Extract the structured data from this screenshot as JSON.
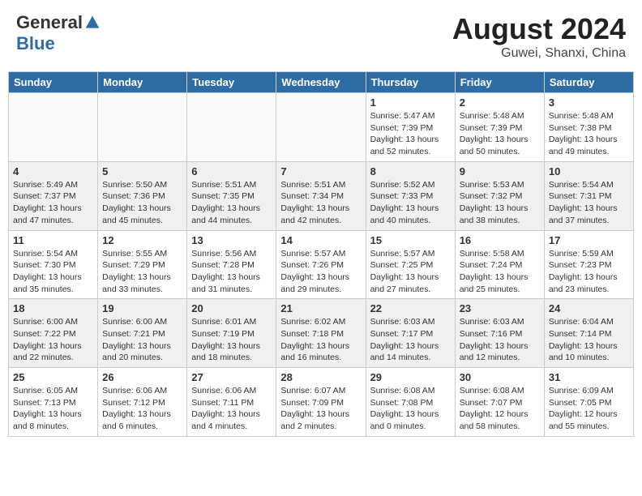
{
  "header": {
    "logo_general": "General",
    "logo_blue": "Blue",
    "title": "August 2024",
    "subtitle": "Guwei, Shanxi, China"
  },
  "days_of_week": [
    "Sunday",
    "Monday",
    "Tuesday",
    "Wednesday",
    "Thursday",
    "Friday",
    "Saturday"
  ],
  "weeks": [
    [
      {
        "day": "",
        "info": ""
      },
      {
        "day": "",
        "info": ""
      },
      {
        "day": "",
        "info": ""
      },
      {
        "day": "",
        "info": ""
      },
      {
        "day": "1",
        "info": "Sunrise: 5:47 AM\nSunset: 7:39 PM\nDaylight: 13 hours\nand 52 minutes."
      },
      {
        "day": "2",
        "info": "Sunrise: 5:48 AM\nSunset: 7:39 PM\nDaylight: 13 hours\nand 50 minutes."
      },
      {
        "day": "3",
        "info": "Sunrise: 5:48 AM\nSunset: 7:38 PM\nDaylight: 13 hours\nand 49 minutes."
      }
    ],
    [
      {
        "day": "4",
        "info": "Sunrise: 5:49 AM\nSunset: 7:37 PM\nDaylight: 13 hours\nand 47 minutes."
      },
      {
        "day": "5",
        "info": "Sunrise: 5:50 AM\nSunset: 7:36 PM\nDaylight: 13 hours\nand 45 minutes."
      },
      {
        "day": "6",
        "info": "Sunrise: 5:51 AM\nSunset: 7:35 PM\nDaylight: 13 hours\nand 44 minutes."
      },
      {
        "day": "7",
        "info": "Sunrise: 5:51 AM\nSunset: 7:34 PM\nDaylight: 13 hours\nand 42 minutes."
      },
      {
        "day": "8",
        "info": "Sunrise: 5:52 AM\nSunset: 7:33 PM\nDaylight: 13 hours\nand 40 minutes."
      },
      {
        "day": "9",
        "info": "Sunrise: 5:53 AM\nSunset: 7:32 PM\nDaylight: 13 hours\nand 38 minutes."
      },
      {
        "day": "10",
        "info": "Sunrise: 5:54 AM\nSunset: 7:31 PM\nDaylight: 13 hours\nand 37 minutes."
      }
    ],
    [
      {
        "day": "11",
        "info": "Sunrise: 5:54 AM\nSunset: 7:30 PM\nDaylight: 13 hours\nand 35 minutes."
      },
      {
        "day": "12",
        "info": "Sunrise: 5:55 AM\nSunset: 7:29 PM\nDaylight: 13 hours\nand 33 minutes."
      },
      {
        "day": "13",
        "info": "Sunrise: 5:56 AM\nSunset: 7:28 PM\nDaylight: 13 hours\nand 31 minutes."
      },
      {
        "day": "14",
        "info": "Sunrise: 5:57 AM\nSunset: 7:26 PM\nDaylight: 13 hours\nand 29 minutes."
      },
      {
        "day": "15",
        "info": "Sunrise: 5:57 AM\nSunset: 7:25 PM\nDaylight: 13 hours\nand 27 minutes."
      },
      {
        "day": "16",
        "info": "Sunrise: 5:58 AM\nSunset: 7:24 PM\nDaylight: 13 hours\nand 25 minutes."
      },
      {
        "day": "17",
        "info": "Sunrise: 5:59 AM\nSunset: 7:23 PM\nDaylight: 13 hours\nand 23 minutes."
      }
    ],
    [
      {
        "day": "18",
        "info": "Sunrise: 6:00 AM\nSunset: 7:22 PM\nDaylight: 13 hours\nand 22 minutes."
      },
      {
        "day": "19",
        "info": "Sunrise: 6:00 AM\nSunset: 7:21 PM\nDaylight: 13 hours\nand 20 minutes."
      },
      {
        "day": "20",
        "info": "Sunrise: 6:01 AM\nSunset: 7:19 PM\nDaylight: 13 hours\nand 18 minutes."
      },
      {
        "day": "21",
        "info": "Sunrise: 6:02 AM\nSunset: 7:18 PM\nDaylight: 13 hours\nand 16 minutes."
      },
      {
        "day": "22",
        "info": "Sunrise: 6:03 AM\nSunset: 7:17 PM\nDaylight: 13 hours\nand 14 minutes."
      },
      {
        "day": "23",
        "info": "Sunrise: 6:03 AM\nSunset: 7:16 PM\nDaylight: 13 hours\nand 12 minutes."
      },
      {
        "day": "24",
        "info": "Sunrise: 6:04 AM\nSunset: 7:14 PM\nDaylight: 13 hours\nand 10 minutes."
      }
    ],
    [
      {
        "day": "25",
        "info": "Sunrise: 6:05 AM\nSunset: 7:13 PM\nDaylight: 13 hours\nand 8 minutes."
      },
      {
        "day": "26",
        "info": "Sunrise: 6:06 AM\nSunset: 7:12 PM\nDaylight: 13 hours\nand 6 minutes."
      },
      {
        "day": "27",
        "info": "Sunrise: 6:06 AM\nSunset: 7:11 PM\nDaylight: 13 hours\nand 4 minutes."
      },
      {
        "day": "28",
        "info": "Sunrise: 6:07 AM\nSunset: 7:09 PM\nDaylight: 13 hours\nand 2 minutes."
      },
      {
        "day": "29",
        "info": "Sunrise: 6:08 AM\nSunset: 7:08 PM\nDaylight: 13 hours\nand 0 minutes."
      },
      {
        "day": "30",
        "info": "Sunrise: 6:08 AM\nSunset: 7:07 PM\nDaylight: 12 hours\nand 58 minutes."
      },
      {
        "day": "31",
        "info": "Sunrise: 6:09 AM\nSunset: 7:05 PM\nDaylight: 12 hours\nand 55 minutes."
      }
    ]
  ]
}
